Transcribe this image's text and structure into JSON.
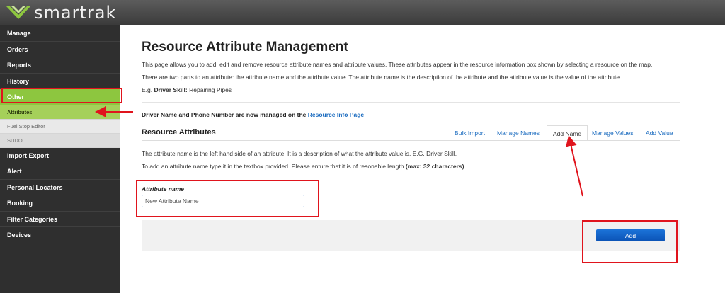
{
  "app": {
    "name": "smartrak"
  },
  "sidebar": {
    "items": [
      {
        "label": "Manage"
      },
      {
        "label": "Orders"
      },
      {
        "label": "Reports"
      },
      {
        "label": "History"
      },
      {
        "label": "Other"
      }
    ],
    "sub_items": [
      {
        "label": "Attributes"
      },
      {
        "label": "Fuel Stop Editor"
      },
      {
        "label": "SUDO"
      }
    ],
    "items_after": [
      {
        "label": "Import Export"
      },
      {
        "label": "Alert"
      },
      {
        "label": "Personal Locators"
      },
      {
        "label": "Booking"
      },
      {
        "label": "Filter Categories"
      },
      {
        "label": "Devices"
      }
    ]
  },
  "page": {
    "title": "Resource Attribute Management",
    "intro_1": "This page allows you to add, edit and remove resource attribute names and attribute values. These attributes appear in the resource information box shown by selecting a resource on the map.",
    "intro_2": "There are two parts to an attribute: the attribute name and the attribute value. The attribute name is the description of the attribute and the attribute value is the value of the attribute.",
    "example_prefix": "E.g.",
    "example_bold": "Driver Skill:",
    "example_value": "Repairing Pipes",
    "notice_text": "Driver Name and Phone Number are now managed on the",
    "notice_link": "Resource Info Page"
  },
  "section": {
    "title": "Resource Attributes",
    "tabs": [
      {
        "label": "Bulk Import"
      },
      {
        "label": "Manage Names"
      },
      {
        "label": "Add Name"
      },
      {
        "label": "Manage Values"
      },
      {
        "label": "Add Value"
      }
    ],
    "selected_tab": "Add Name",
    "desc_1": "The attribute name is the left hand side of an attribute. It is a description of what the attribute value is. E.G. Driver Skill.",
    "desc_2_prefix": "To add an attribute name type it in the textbox provided. Please enture that it is of resonable length",
    "desc_2_bold": "(max: 32 characters)",
    "desc_2_suffix": ".",
    "field_label": "Attribute name",
    "field_placeholder": "New Attribute Name",
    "add_button": "Add"
  },
  "colors": {
    "topbar": "#4a4a4a",
    "sidebar": "#2f2f2f",
    "active_green": "#8dc63f",
    "link": "#1a6bbf",
    "button": "#0b52b5",
    "annotation": "#e0141d"
  }
}
